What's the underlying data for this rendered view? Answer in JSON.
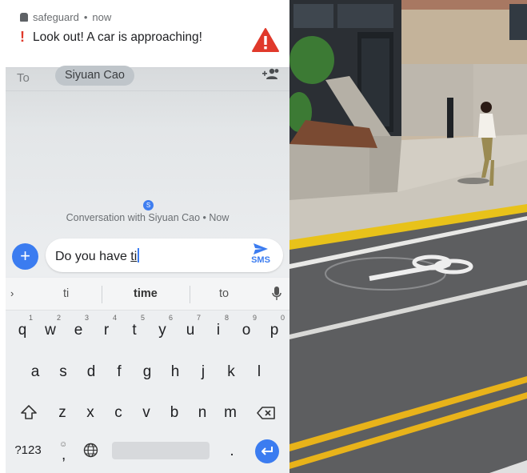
{
  "notification": {
    "app_name": "safeguard",
    "time": "now",
    "message": "Look out! A car is approaching!"
  },
  "recipient": {
    "to_label": "To",
    "name": "Siyuan Cao"
  },
  "conversation": {
    "avatar_letter": "S",
    "label": "Conversation with Siyuan Cao • Now"
  },
  "compose": {
    "typed_text": "Do you have ",
    "underlined_word": "ti",
    "send_label": "SMS"
  },
  "keyboard": {
    "suggestions": [
      "ti",
      "time",
      "to"
    ],
    "row1": [
      {
        "k": "q",
        "h": "1"
      },
      {
        "k": "w",
        "h": "2"
      },
      {
        "k": "e",
        "h": "3"
      },
      {
        "k": "r",
        "h": "4"
      },
      {
        "k": "t",
        "h": "5"
      },
      {
        "k": "y",
        "h": "6"
      },
      {
        "k": "u",
        "h": "7"
      },
      {
        "k": "i",
        "h": "8"
      },
      {
        "k": "o",
        "h": "9"
      },
      {
        "k": "p",
        "h": "0"
      }
    ],
    "row2": [
      "a",
      "s",
      "d",
      "f",
      "g",
      "h",
      "j",
      "k",
      "l"
    ],
    "row3": [
      "z",
      "x",
      "c",
      "v",
      "b",
      "n",
      "m"
    ],
    "symbols_label": "?123",
    "comma": ",",
    "period": "."
  },
  "colors": {
    "accent": "#3b7cf0",
    "alert": "#e0392b"
  }
}
